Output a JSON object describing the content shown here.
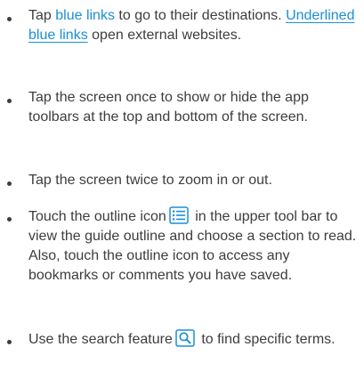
{
  "tips": {
    "links": {
      "blue_link_text": "blue links",
      "after_blue": " to go to their destinations. ",
      "underlined_link_text": "Underlined blue links",
      "before_blue": "Tap ",
      "after_underlined": " open external websites."
    },
    "toolbars": {
      "text": "Tap the screen once to show or hide the app toolbars at the top and bottom of the screen."
    },
    "zoom": {
      "text": "Tap the screen twice to zoom in or out."
    },
    "outline": {
      "before_icon": "Touch the outline icon",
      "after_icon": " in the upper tool bar to view the guide outline and choose a section to read. Also, touch the outline icon to access any bookmarks or comments you have saved."
    },
    "search": {
      "before_icon": "Use the search feature",
      "after_icon": " to find specific terms."
    }
  },
  "icons": {
    "outline": "outline-icon",
    "search": "search-icon"
  },
  "colors": {
    "text": "#3d3d3d",
    "link": "#1a8fd6",
    "icon": "#1a8fd6"
  }
}
